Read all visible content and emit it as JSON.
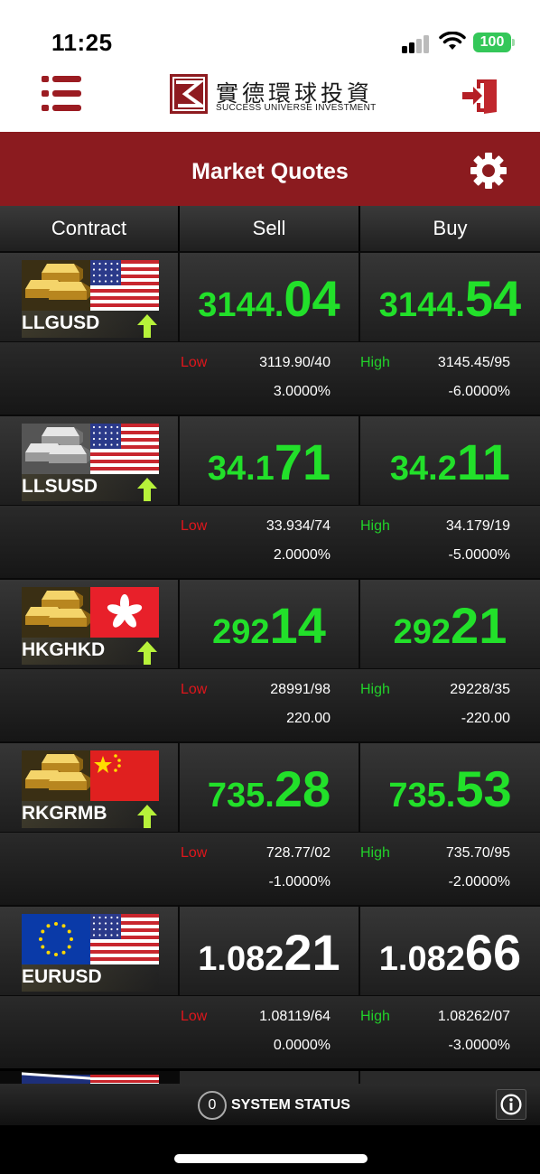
{
  "status_bar": {
    "time": "11:25",
    "battery": "100"
  },
  "header": {
    "logo_cn": "實德環球投資",
    "logo_en": "SUCCESS UNIVERSE INVESTMENT",
    "menu_icon": "list-menu-icon",
    "exit_icon": "exit-door-icon"
  },
  "title": "Market Quotes",
  "columns": {
    "contract": "Contract",
    "sell": "Sell",
    "buy": "Buy"
  },
  "labels": {
    "low": "Low",
    "high": "High"
  },
  "quotes": [
    {
      "code": "LLGUSD",
      "metal": "gold",
      "flag": "us",
      "trend": "up",
      "sell_small": "3144.",
      "sell_big": "04",
      "buy_small": "3144.",
      "buy_big": "54",
      "low": "3119.90/40",
      "high": "3145.45/95",
      "sell_change": "3.0000%",
      "buy_change": "-6.0000%",
      "color": "green"
    },
    {
      "code": "LLSUSD",
      "metal": "silver",
      "flag": "us",
      "trend": "up",
      "sell_small": "34.1",
      "sell_big": "71",
      "buy_small": "34.2",
      "buy_big": "11",
      "low": "33.934/74",
      "high": "34.179/19",
      "sell_change": "2.0000%",
      "buy_change": "-5.0000%",
      "color": "green"
    },
    {
      "code": "HKGHKD",
      "metal": "gold",
      "flag": "hk",
      "trend": "up",
      "sell_small": "292",
      "sell_big": "14",
      "buy_small": "292",
      "buy_big": "21",
      "low": "28991/98",
      "high": "29228/35",
      "sell_change": "220.00",
      "buy_change": "-220.00",
      "color": "green"
    },
    {
      "code": "RKGRMB",
      "metal": "gold",
      "flag": "cn",
      "trend": "up",
      "sell_small": "735.",
      "sell_big": "28",
      "buy_small": "735.",
      "buy_big": "53",
      "low": "728.77/02",
      "high": "735.70/95",
      "sell_change": "-1.0000%",
      "buy_change": "-2.0000%",
      "color": "green"
    },
    {
      "code": "EURUSD",
      "metal": "eu",
      "flag": "us",
      "trend": "none",
      "sell_small": "1.082",
      "sell_big": "21",
      "buy_small": "1.082",
      "buy_big": "66",
      "low": "1.08119/64",
      "high": "1.08262/07",
      "sell_change": "0.0000%",
      "buy_change": "-3.0000%",
      "color": "white"
    }
  ],
  "footer": {
    "system_count": "0",
    "system_label": "SYSTEM STATUS",
    "info_icon": "info-icon"
  },
  "colors": {
    "brand": "#8b1b1f",
    "up": "#22e02a",
    "low": "#e0161c"
  }
}
